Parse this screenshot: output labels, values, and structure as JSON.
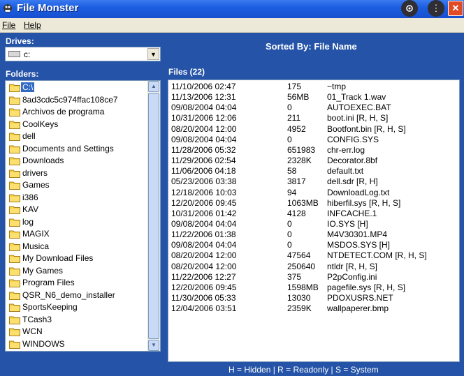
{
  "window": {
    "title": "File Monster",
    "accent": "#2453a7"
  },
  "menu": [
    "File",
    "Help"
  ],
  "drives": {
    "label": "Drives:",
    "selected": "c:",
    "icon": "hard-drive-icon"
  },
  "sorted_by": "Sorted By: File Name",
  "folders": {
    "label": "Folders:",
    "items": [
      "C:\\",
      "8ad3cdc5c974ffac108ce7",
      "Archivos de programa",
      "CoolKeys",
      "dell",
      "Documents and Settings",
      "Downloads",
      "drivers",
      "Games",
      "i386",
      "KAV",
      "log",
      "MAGIX",
      "Musica",
      "My Download Files",
      "My Games",
      "Program Files",
      "QSR_N6_demo_installer",
      "SportsKeeping",
      "TCash3",
      "WCN",
      "WINDOWS"
    ],
    "selected_index": 0
  },
  "files": {
    "label": "Files (22)",
    "rows": [
      {
        "date": "11/10/2006 02:47",
        "size": "175",
        "name": "~tmp"
      },
      {
        "date": "11/13/2006 12:31",
        "size": "56MB",
        "name": "01_Track 1.wav"
      },
      {
        "date": "09/08/2004 04:04",
        "size": "0",
        "name": "AUTOEXEC.BAT"
      },
      {
        "date": "10/31/2006 12:06",
        "size": "211",
        "name": "boot.ini   [R, H, S]"
      },
      {
        "date": "08/20/2004 12:00",
        "size": "4952",
        "name": "Bootfont.bin   [R, H, S]"
      },
      {
        "date": "09/08/2004 04:04",
        "size": "0",
        "name": "CONFIG.SYS"
      },
      {
        "date": "11/28/2006 05:32",
        "size": "651983",
        "name": "chr-err.log"
      },
      {
        "date": "11/29/2006 02:54",
        "size": "2328K",
        "name": "Decorator.8bf"
      },
      {
        "date": "11/06/2006 04:18",
        "size": "58",
        "name": "default.txt"
      },
      {
        "date": "05/23/2006 03:38",
        "size": "3817",
        "name": "dell.sdr   [R, H]"
      },
      {
        "date": "12/18/2006 10:03",
        "size": "94",
        "name": "DownloadLog.txt"
      },
      {
        "date": "12/20/2006 09:45",
        "size": "1063MB",
        "name": "hiberfil.sys   [R, H, S]"
      },
      {
        "date": "10/31/2006 01:42",
        "size": "4128",
        "name": "INFCACHE.1"
      },
      {
        "date": "09/08/2004 04:04",
        "size": "0",
        "name": "IO.SYS   [H]"
      },
      {
        "date": "11/22/2006 01:38",
        "size": "0",
        "name": "M4V30301.MP4"
      },
      {
        "date": "09/08/2004 04:04",
        "size": "0",
        "name": "MSDOS.SYS   [H]"
      },
      {
        "date": "08/20/2004 12:00",
        "size": "47564",
        "name": "NTDETECT.COM   [R, H, S]"
      },
      {
        "date": "08/20/2004 12:00",
        "size": "250640",
        "name": "ntldr   [R, H, S]"
      },
      {
        "date": "11/22/2006 12:27",
        "size": "375",
        "name": "P2pConfig.ini"
      },
      {
        "date": "12/20/2006 09:45",
        "size": "1598MB",
        "name": "pagefile.sys   [R, H, S]"
      },
      {
        "date": "11/30/2006 05:33",
        "size": "13030",
        "name": "PDOXUSRS.NET"
      },
      {
        "date": "12/04/2006 03:51",
        "size": "2359K",
        "name": "wallpaperer.bmp"
      }
    ]
  },
  "legend": "H = Hidden   |   R = Readonly   |   S = System"
}
